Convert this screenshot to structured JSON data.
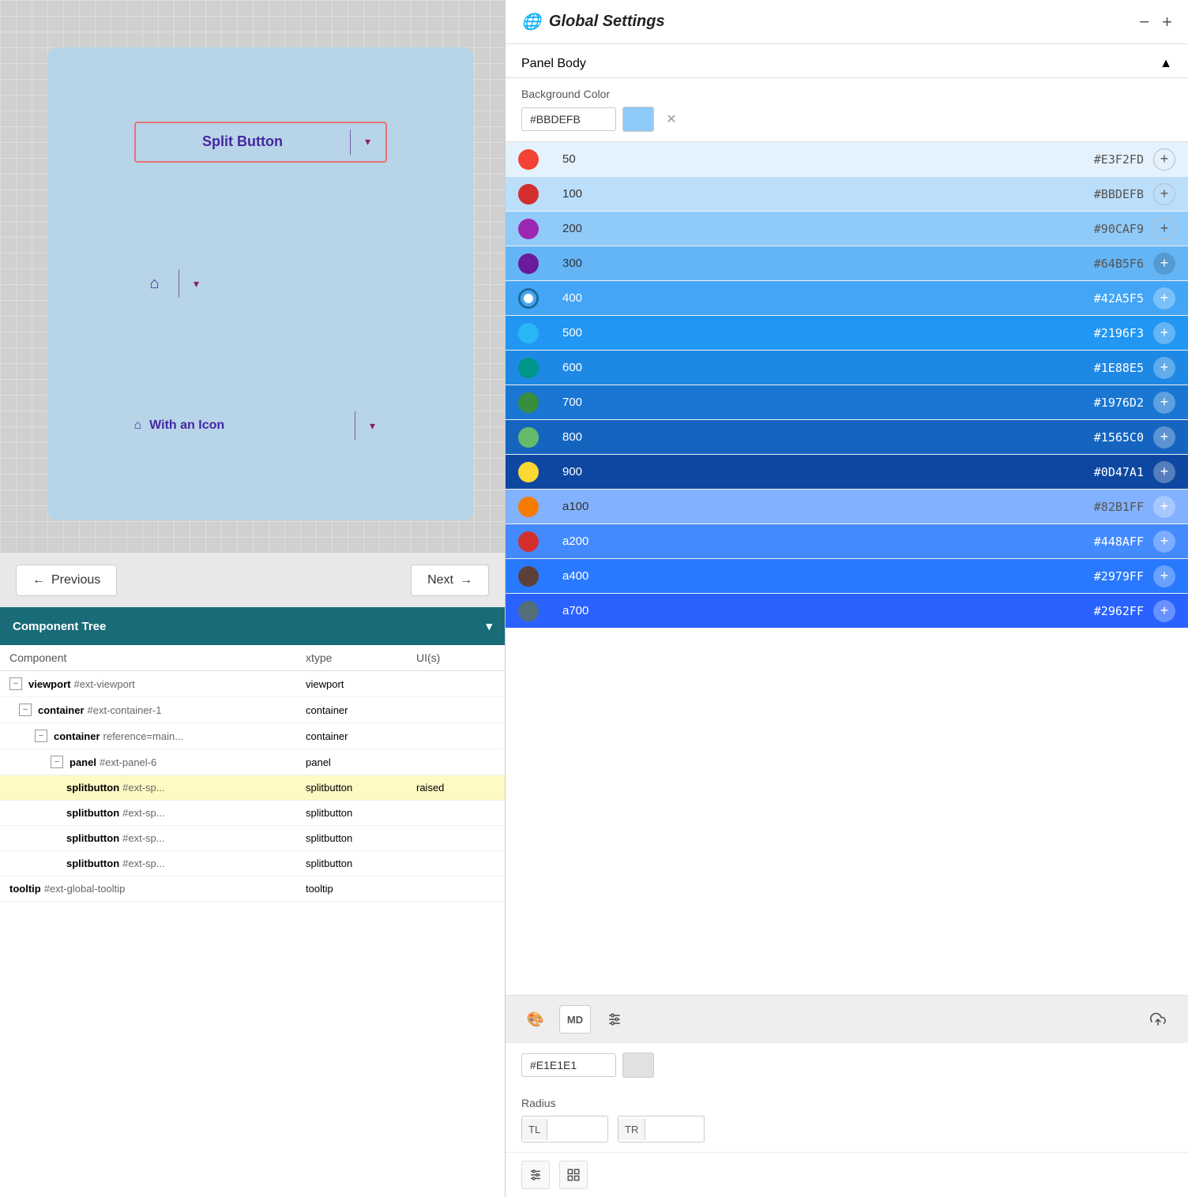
{
  "left": {
    "canvas": {
      "split_button_label": "Split Button",
      "with_icon_label": "With an Icon"
    },
    "nav": {
      "previous_label": "Previous",
      "next_label": "Next"
    },
    "component_tree": {
      "header_label": "Component Tree",
      "columns": {
        "component": "Component",
        "xtype": "xtype",
        "uis": "UI(s)"
      },
      "rows": [
        {
          "indent": 0,
          "name": "viewport",
          "id": "#ext-viewport",
          "xtype": "viewport",
          "ui": "",
          "collapsed": false
        },
        {
          "indent": 1,
          "name": "container",
          "id": "#ext-container-1",
          "xtype": "container",
          "ui": "",
          "collapsed": false
        },
        {
          "indent": 2,
          "name": "container",
          "id": "reference=main...",
          "xtype": "container",
          "ui": "",
          "collapsed": false
        },
        {
          "indent": 3,
          "name": "panel",
          "id": "#ext-panel-6",
          "xtype": "panel",
          "ui": "",
          "collapsed": false
        },
        {
          "indent": 4,
          "name": "splitbutton",
          "id": "#ext-sp...",
          "xtype": "splitbutton",
          "ui": "raised",
          "highlighted": true
        },
        {
          "indent": 4,
          "name": "splitbutton",
          "id": "#ext-sp...",
          "xtype": "splitbutton",
          "ui": ""
        },
        {
          "indent": 4,
          "name": "splitbutton",
          "id": "#ext-sp...",
          "xtype": "splitbutton",
          "ui": ""
        },
        {
          "indent": 4,
          "name": "splitbutton",
          "id": "#ext-sp...",
          "xtype": "splitbutton",
          "ui": ""
        },
        {
          "indent": 0,
          "name": "tooltip",
          "id": "#ext-global-tooltip",
          "xtype": "tooltip",
          "ui": ""
        }
      ]
    }
  },
  "right": {
    "header": {
      "title": "Global Settings",
      "globe_icon": "🌐",
      "minimize_label": "−",
      "expand_label": "+"
    },
    "panel_body": {
      "title": "Panel Body",
      "collapse_icon": "▲"
    },
    "background_color": {
      "label": "Background Color",
      "value": "#BBDEFB",
      "swatch_color": "#90caf9",
      "clear_icon": "✕"
    },
    "colors": [
      {
        "key": "50",
        "hex": "#E3F2FD",
        "bg": "#e3f2fd",
        "text_dark": true
      },
      {
        "key": "100",
        "hex": "#BBDEFB",
        "bg": "#bbdefb",
        "text_dark": true,
        "selected": false
      },
      {
        "key": "200",
        "hex": "#90CAF9",
        "bg": "#90caf9",
        "text_dark": true
      },
      {
        "key": "300",
        "hex": "#64B5F6",
        "bg": "#64b5f6",
        "text_dark": true
      },
      {
        "key": "400",
        "hex": "#42A5F5",
        "bg": "#42a5f5",
        "text_white": true
      },
      {
        "key": "500",
        "hex": "#2196F3",
        "bg": "#2196f3",
        "text_white": true
      },
      {
        "key": "600",
        "hex": "#1E88E5",
        "bg": "#1e88e5",
        "text_white": true
      },
      {
        "key": "700",
        "hex": "#1976D2",
        "bg": "#1976d2",
        "text_white": true
      },
      {
        "key": "800",
        "hex": "#1565C0",
        "bg": "#1565c0",
        "text_white": true
      },
      {
        "key": "900",
        "hex": "#0D47A1",
        "bg": "#0d47a1",
        "text_white": true
      },
      {
        "key": "a100",
        "hex": "#82B1FF",
        "bg": "#82b1ff",
        "text_dark": true
      },
      {
        "key": "a200",
        "hex": "#448AFF",
        "bg": "#448aff",
        "text_white": true
      },
      {
        "key": "a400",
        "hex": "#2979FF",
        "bg": "#2979ff",
        "text_white": true
      },
      {
        "key": "a700",
        "hex": "#2962FF",
        "bg": "#2962ff",
        "text_white": true
      }
    ],
    "palette_footer": {
      "palette_icon": "🎨",
      "md_label": "MD",
      "sliders_icon": "⚙",
      "upload_icon": "⬆"
    },
    "second_input": {
      "value": "#E1E1E1"
    },
    "radius": {
      "label": "Radius",
      "tl_label": "TL",
      "tr_label": "TR"
    },
    "bottom_toolbar": {
      "sliders_icon": "⊞",
      "grid_icon": "⊟"
    }
  }
}
